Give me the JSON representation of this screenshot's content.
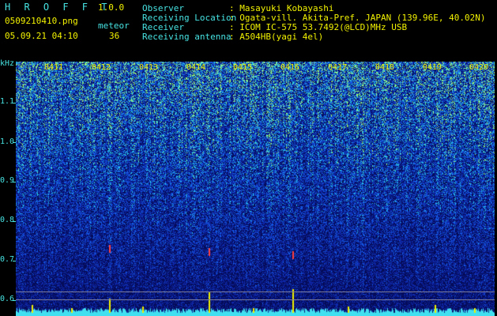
{
  "header": {
    "app_title": "H R O F F T",
    "version": "1.0.0",
    "filename": "0509210410.png",
    "meteor_label": "meteor",
    "datetime": "05.09.21 04:10",
    "meteor_count": "36",
    "info_labels": [
      "Observer",
      "Receiving Location",
      "Receiver",
      "Receiving antenna"
    ],
    "info_values": [
      ": Masayuki Kobayashi",
      ": Ogata-vill. Akita-Pref. JAPAN (139.96E, 40.02N)",
      ": ICOM IC-575 53.7492(@LCD)MHz USB",
      ": A504HB(yagi 4el)"
    ]
  },
  "axis": {
    "unit": "kHz",
    "y_ticks": [
      "1.1",
      "1.0",
      "0.9",
      "0.8",
      "0.7",
      "0.6"
    ],
    "time_labels": [
      "0411",
      "0412",
      "0413",
      "0414",
      "0415",
      "0416",
      "0417",
      "0418",
      "0419",
      "0420"
    ]
  },
  "colors": {
    "header_text": "#47e3e3",
    "value_text": "#f2f200",
    "background": "#000000"
  }
}
